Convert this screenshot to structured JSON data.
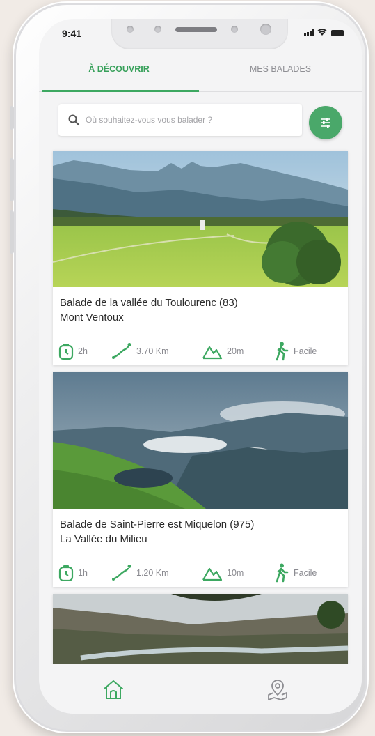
{
  "status": {
    "time": "9:41"
  },
  "tabs": [
    {
      "label": "À DÉCOUVRIR",
      "active": true
    },
    {
      "label": "MES BALADES",
      "active": false
    }
  ],
  "search": {
    "placeholder": "Où souhaitez-vous vous balader ?"
  },
  "cards": [
    {
      "title_line1": "Balade de la vallée du Toulourenc (83)",
      "title_line2": "Mont Ventoux",
      "duration": "2h",
      "distance": "3.70 Km",
      "elevation": "20m",
      "difficulty": "Facile"
    },
    {
      "title_line1": "Balade de Saint-Pierre est Miquelon (975)",
      "title_line2": "La Vallée du Milieu",
      "duration": "1h",
      "distance": "1.20 Km",
      "elevation": "10m",
      "difficulty": "Facile"
    }
  ],
  "colors": {
    "accent": "#3da861",
    "background": "#f1ebe6",
    "screen": "#f4f4f5"
  },
  "icons": [
    "search-icon",
    "filter-icon",
    "stopwatch-icon",
    "path-icon",
    "mountain-icon",
    "hiker-icon",
    "home-icon",
    "map-pin-icon"
  ]
}
